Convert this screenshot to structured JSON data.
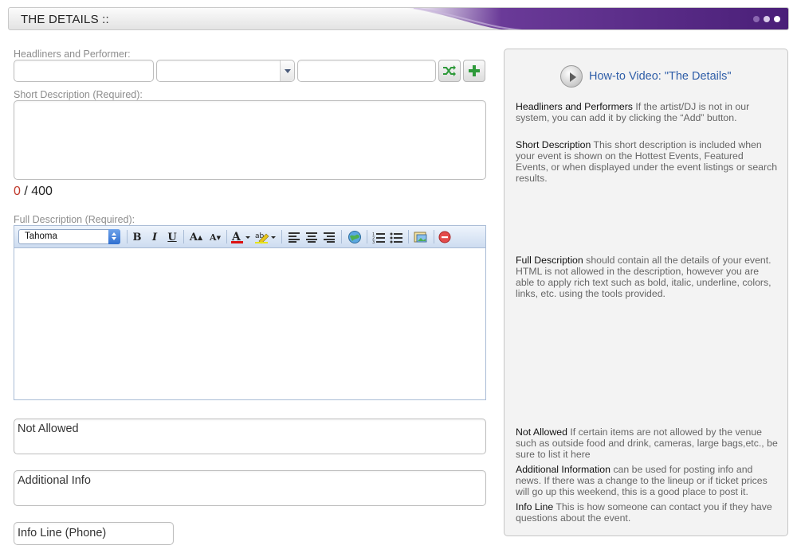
{
  "header": {
    "title": "THE DETAILS ::"
  },
  "headliners": {
    "label": "Headliners and Performer:",
    "input1_value": "",
    "select_value": "",
    "input2_value": ""
  },
  "short_desc": {
    "label": "Short Description (Required):",
    "value": "",
    "count_current": "0",
    "count_sep": " / ",
    "count_max": "400"
  },
  "full_desc": {
    "label": "Full Description (Required):",
    "font": "Tahoma",
    "value": ""
  },
  "toolbar_icons": [
    "bold-icon",
    "italic-icon",
    "underline-icon",
    "font-size-increase-icon",
    "font-size-decrease-icon",
    "text-color-icon",
    "highlight-icon",
    "align-left-icon",
    "align-center-icon",
    "align-right-icon",
    "link-icon",
    "ordered-list-icon",
    "unordered-list-icon",
    "image-icon",
    "remove-format-icon"
  ],
  "fields": {
    "not_allowed_placeholder": "Not Allowed",
    "additional_info_placeholder": "Additional Info",
    "info_line_placeholder": "Info Line (Phone)"
  },
  "help": {
    "video_link": "How-to Video: \"The Details\"",
    "headliners_term": "Headliners and Performers",
    "headliners_text": " If the artist/DJ is not in our system, you can add it by clicking the “Add” button.",
    "short_term": "Short Description",
    "short_text": " This short description is included when your event is shown on the Hottest Events, Featured Events, or when displayed under the event listings or search results.",
    "full_term": "Full Description",
    "full_text": " should contain all the details of your event. HTML is not allowed in the description, however you are able to apply rich text such as bold, italic, underline, colors, links, etc. using the tools provided.",
    "not_allowed_term": "Not Allowed",
    "not_allowed_text": " If certain items are not allowed by the venue such as outside food and drink, cameras, large bags,etc., be sure to list it here",
    "additional_term": "Additional Information",
    "additional_text": " can be used for posting info and news. If there was a change to the lineup or if ticket prices will go up this weekend, this is a good place to post it.",
    "info_line_term": "Info Line",
    "info_line_text": " This is how someone can contact you if they have questions about the event."
  },
  "colors": {
    "accent_purple": "#5b2d86",
    "counter_red": "#c0392b",
    "link_blue": "#2f5ea8"
  }
}
